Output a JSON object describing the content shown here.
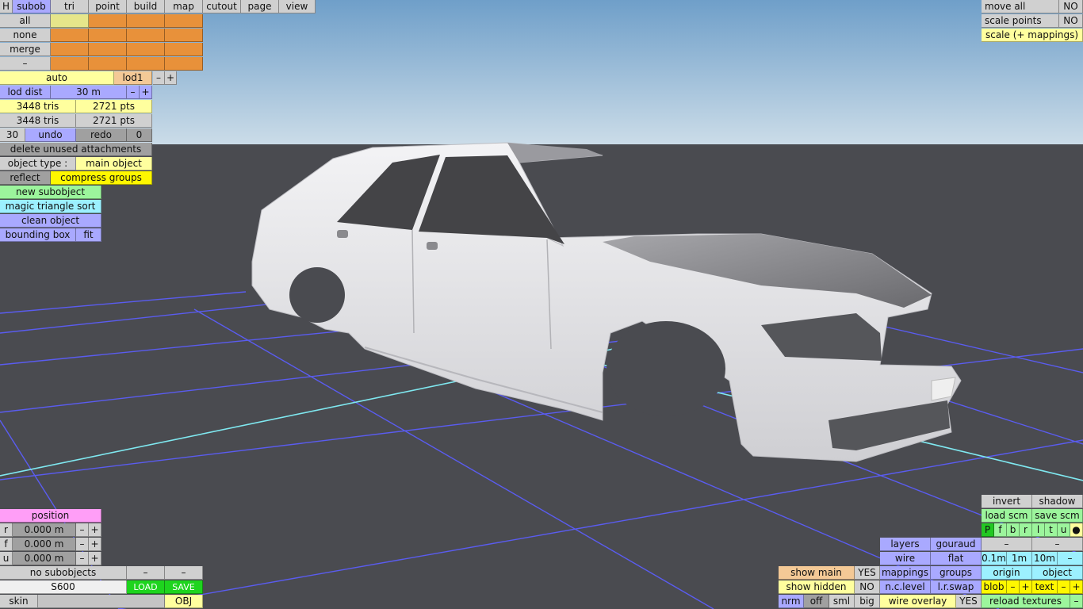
{
  "top_tabs": [
    "H",
    "subob",
    "tri",
    "point",
    "build",
    "map",
    "cutout",
    "page",
    "view"
  ],
  "select_rows": [
    "all",
    "none",
    "merge",
    "–"
  ],
  "lod": {
    "auto": "auto",
    "level": "lod1",
    "minus": "–",
    "plus": "+"
  },
  "lod_dist": {
    "label": "lod dist",
    "value": "30 m",
    "minus": "–",
    "plus": "+"
  },
  "stats": [
    {
      "tris": "3448 tris",
      "pts": "2721 pts"
    },
    {
      "tris": "3448 tris",
      "pts": "2721 pts"
    }
  ],
  "undo_row": {
    "count": "30",
    "undo": "undo",
    "redo": "redo",
    "redo_count": "0"
  },
  "delete_unused": "delete unused attachments",
  "object_type": {
    "label": "object type :",
    "value": "main object"
  },
  "reflect": "reflect",
  "compress_groups": "compress groups",
  "new_subobject": "new subobject",
  "magic_sort": "magic triangle sort",
  "clean_object": "clean object",
  "bounding_box": {
    "label": "bounding box",
    "fit": "fit"
  },
  "top_right": [
    {
      "label": "move all",
      "value": "NO"
    },
    {
      "label": "scale points",
      "value": "NO"
    }
  ],
  "scale_mappings": "scale (+ mappings)",
  "position": {
    "title": "position",
    "rows": [
      {
        "axis": "r",
        "value": "0.000 m"
      },
      {
        "axis": "f",
        "value": "0.000 m"
      },
      {
        "axis": "u",
        "value": "0.000 m"
      }
    ],
    "minus": "–",
    "plus": "+"
  },
  "bottom_left": {
    "no_subobjects": "no subobjects",
    "dash1": "–",
    "dash2": "–",
    "name": "S600",
    "load": "LOAD",
    "save": "SAVE",
    "skin": "skin",
    "obj": "OBJ"
  },
  "bottom_right": {
    "invert": "invert",
    "shadow": "shadow",
    "load_scm": "load scm",
    "save_scm": "save scm",
    "letters": [
      "P",
      "f",
      "b",
      "r",
      "l",
      "t",
      "u",
      "●"
    ],
    "layers": "layers",
    "gouraud": "gouraud",
    "wire": "wire",
    "flat": "flat",
    "dist": [
      "0.1m",
      "1m",
      "10m",
      "–"
    ],
    "dash": "–",
    "mappings": "mappings",
    "groups": "groups",
    "origin": "origin",
    "object": "object",
    "nc_level": "n.c.level",
    "lr_swap": "l.r.swap",
    "blob": "blob",
    "text": "text",
    "wire_overlay": "wire overlay",
    "wire_overlay_val": "YES",
    "reload_textures": "reload textures",
    "show_main": "show main",
    "show_main_val": "YES",
    "show_hidden": "show hidden",
    "show_hidden_val": "NO",
    "views": [
      "nrm",
      "off",
      "sml",
      "big"
    ],
    "pm_minus": "–",
    "pm_plus": "+"
  },
  "colors": {
    "sky_top": "#6f9fc9",
    "sky_bottom": "#c9dbe9",
    "ground": "#4a4b50",
    "grid_blue": "#6060ff",
    "grid_cyan": "#7fe8f0"
  }
}
